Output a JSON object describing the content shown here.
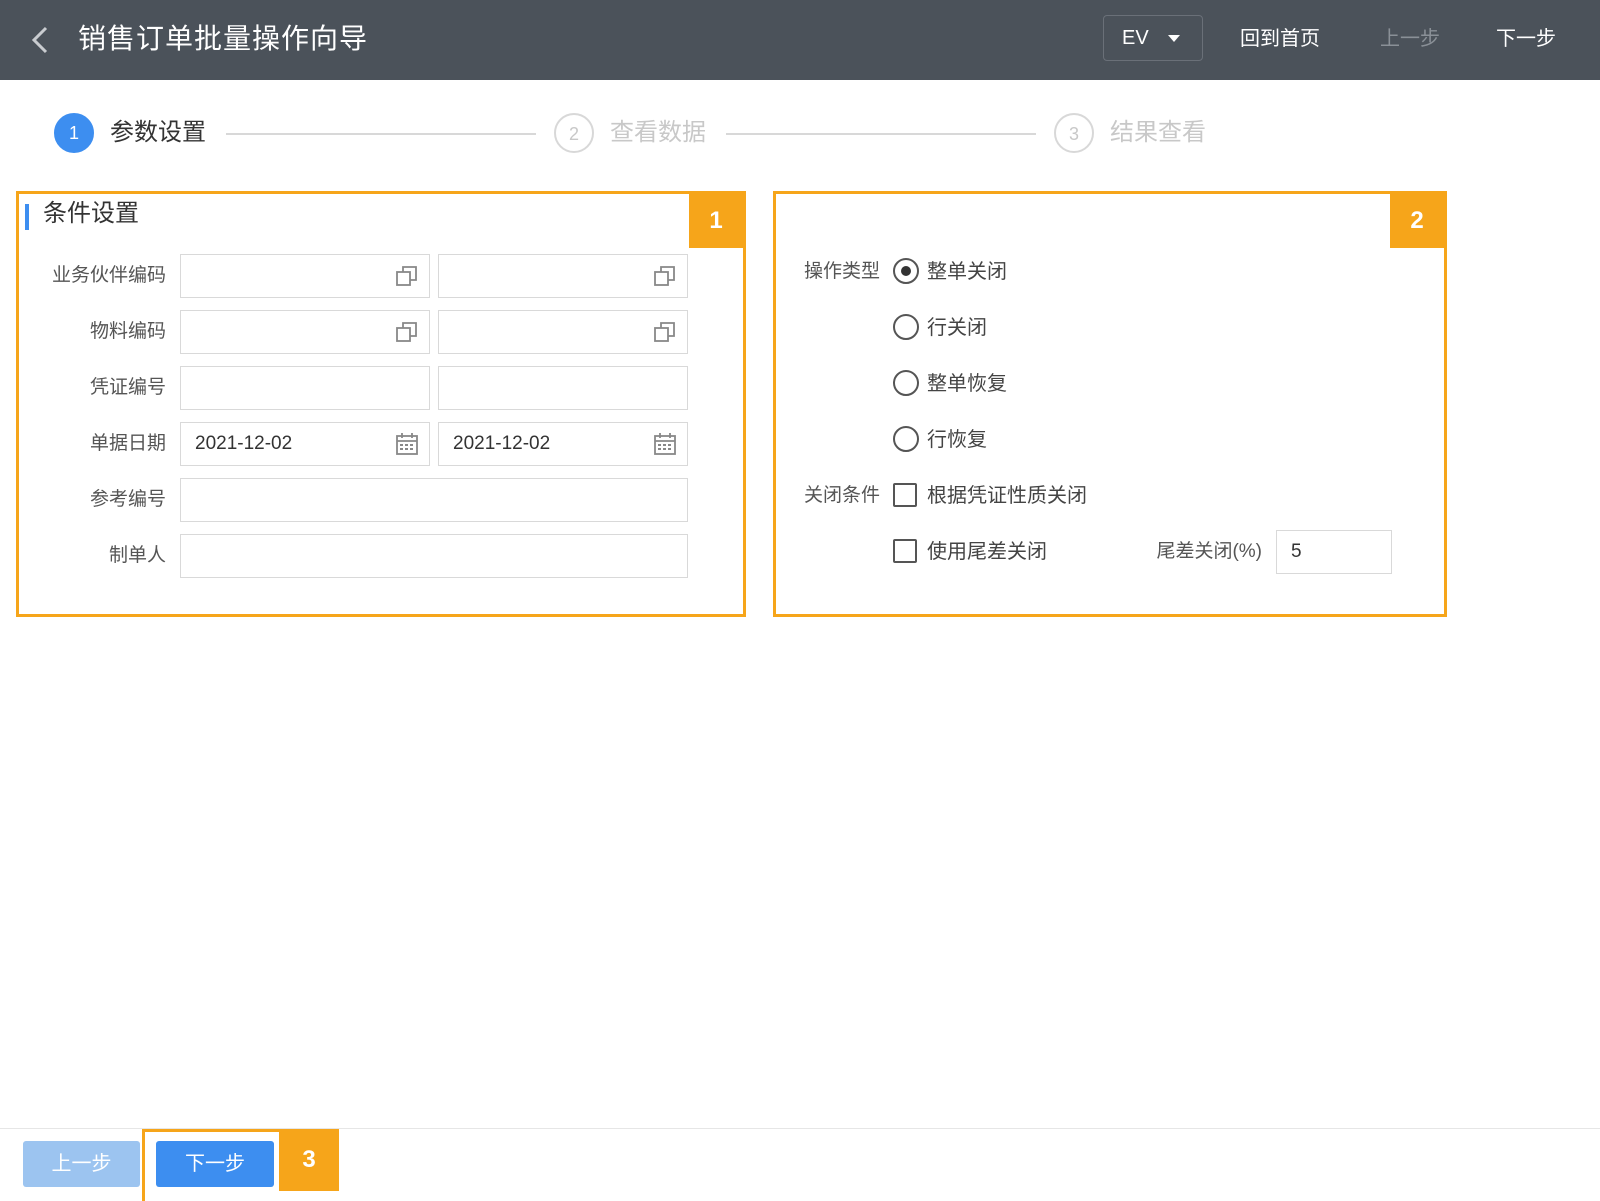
{
  "header": {
    "title": "销售订单批量操作向导",
    "language": "EV",
    "home_label": "回到首页",
    "prev_label": "上一步",
    "next_label": "下一步"
  },
  "steps": [
    {
      "number": "1",
      "label": "参数设置",
      "state": "active"
    },
    {
      "number": "2",
      "label": "查看数据",
      "state": "inactive"
    },
    {
      "number": "3",
      "label": "结果查看",
      "state": "inactive"
    }
  ],
  "conditions": {
    "section_title": "条件设置",
    "callout": "1",
    "rows": [
      {
        "label": "业务伙伴编码",
        "from": "",
        "to": "",
        "icon": "lookup-icon"
      },
      {
        "label": "物料编码",
        "from": "",
        "to": "",
        "icon": "lookup-icon"
      },
      {
        "label": "凭证编号",
        "from": "",
        "to": ""
      },
      {
        "label": "单据日期",
        "from": "2021-12-02",
        "to": "2021-12-02",
        "icon": "calendar-icon"
      },
      {
        "label": "参考编号",
        "value": ""
      },
      {
        "label": "制单人",
        "value": ""
      }
    ]
  },
  "operation": {
    "callout": "2",
    "type_label": "操作类型",
    "types": [
      {
        "label": "整单关闭",
        "checked": true
      },
      {
        "label": "行关闭",
        "checked": false
      },
      {
        "label": "整单恢复",
        "checked": false
      },
      {
        "label": "行恢复",
        "checked": false
      }
    ],
    "close_condition_label": "关闭条件",
    "by_voucher_label": "根据凭证性质关闭",
    "by_voucher_checked": false,
    "tolerance_label": "使用尾差关闭",
    "tolerance_checked": false,
    "tolerance_pct_label": "尾差关闭(%)",
    "tolerance_pct_value": "5"
  },
  "footer": {
    "prev_label": "上一步",
    "next_label": "下一步",
    "callout": "3"
  },
  "colors": {
    "topbar": "#4b525a",
    "accent": "#3d8ef0",
    "highlight": "#f6a51a"
  }
}
